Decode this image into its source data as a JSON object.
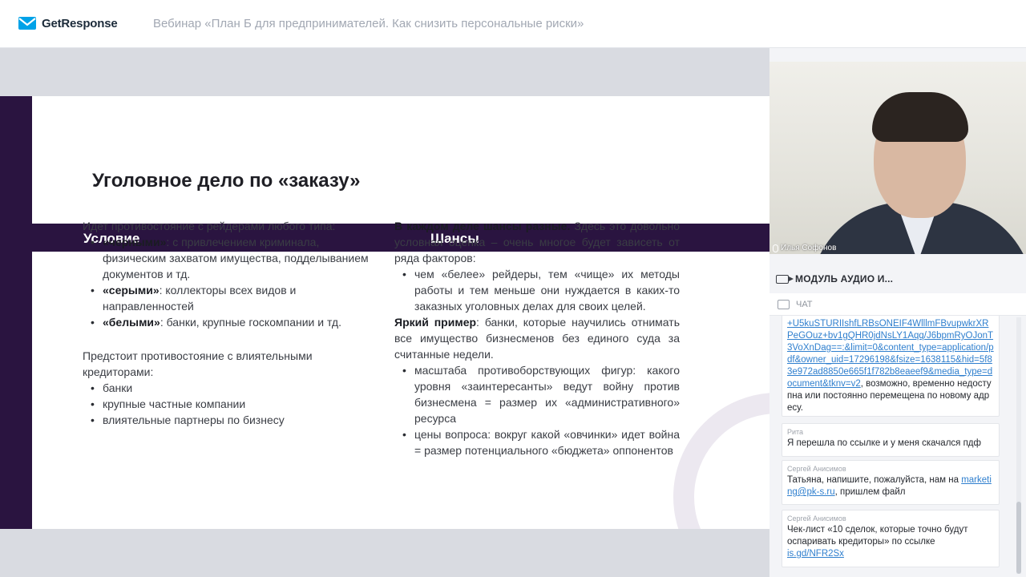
{
  "header": {
    "logo_text": "GetResponse",
    "webinar_title": "Вебинар «План Б для предпринимателей. Как снизить персональные риски»"
  },
  "slide": {
    "title": "Уголовное дело по «заказу»",
    "band_left": "Условие",
    "band_right": "Шансы",
    "left": {
      "intro": "Идет противостояние с рейдерами любого типа:",
      "items": [
        {
          "bold": "«черными»",
          "text": ": с привлечением криминала, физическим захватом имущества, подделыванием документов и тд."
        },
        {
          "bold": "«серыми»",
          "text": ": коллекторы всех видов и направленностей"
        },
        {
          "bold": "«белыми»",
          "text": ": банки, крупные госкомпании и тд."
        }
      ],
      "intro2": "Предстоит противостояние с влиятельными кредиторами:",
      "items2": [
        "банки",
        "крупные частные компании",
        "влиятельные партнеры по бизнесу"
      ]
    },
    "right": {
      "p1_bold": "В каждом деле шансы разные.",
      "p1_text": " Здесь это довольно условная оценка – очень многое будет зависеть от ряда факторов:",
      "items1": [
        "чем «белее» рейдеры, тем «чище» их методы работы и тем меньше они нуждается в каких-то заказных уголовных делах для своих целей."
      ],
      "p2_bold": "Яркий пример",
      "p2_text": ": банки, которые научились отнимать все имущество бизнесменов без единого суда за считанные недели.",
      "items2": [
        "масштаба противоборствующих фигур: какого уровня «заинтересанты» ведут войну против бизнесмена = размер их «административного» ресурса",
        "цены вопроса: вокруг какой «овчинки» идет война = размер потенциального «бюджета» оппонентов"
      ]
    }
  },
  "video": {
    "presenter_name": "Илья Софонов"
  },
  "module": {
    "label": "МОДУЛЬ АУДИО И..."
  },
  "chat": {
    "label": "ЧАТ",
    "messages": [
      {
        "author": "",
        "link_text": "+U5kuSTURIIshfLRBsONEIF4WlllmFBvupwkrXRPeGOuz+bv1gQHR0jdNsLY1Aqq/J6bpmRyOJonT3VoXnDag==:&limit=0&content_type=application/pdf&owner_uid=17296198&fsize=1638115&hid=5f83e972ad8850e665f1f782b8eaeef9&media_type=document&tknv=v2",
        "text": ", возможно, временно недоступна или постоянно перемещена по новому адресу."
      },
      {
        "author": "Рита",
        "text": "Я перешла по ссылке и у меня скачался пдф"
      },
      {
        "author": "Сергей Анисимов",
        "text_before": "Татьяна, напишите, пожалуйста, нам на ",
        "link_text": "marketing@pk-s.ru",
        "text_after": ", пришлем файл"
      },
      {
        "author": "Сергей Анисимов",
        "text_before": "Чек-лист «10 сделок, которые точно будут оспаривать кредиторы» по ссылке ",
        "link_text": "is.gd/NFR2Sx"
      }
    ]
  },
  "colors": {
    "brand_dark": "#2a1440",
    "link": "#2f7fce",
    "logo_blue": "#00a2e8"
  }
}
